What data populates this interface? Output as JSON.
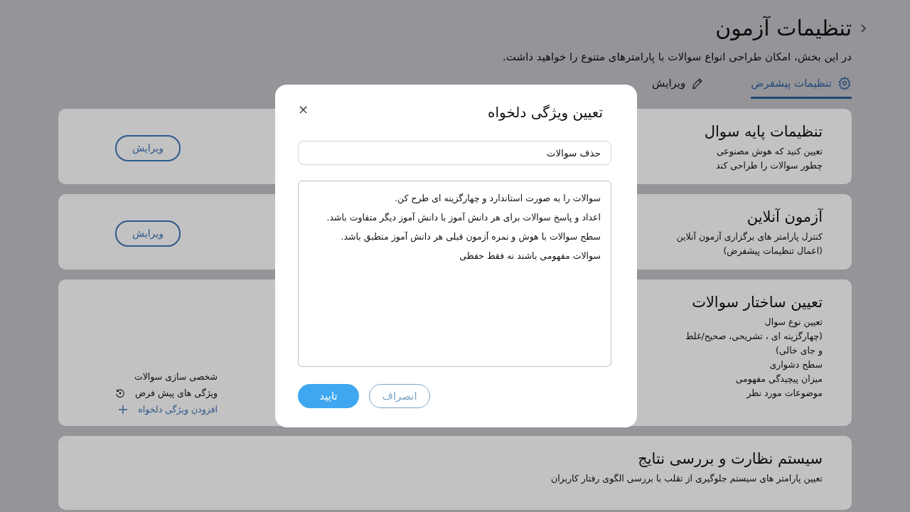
{
  "header": {
    "title": "تنظیمات آزمون",
    "subtitle": "در این بخش، امکان طراحی انواع سوالات با پارامترهای متنوع را خواهید داشت."
  },
  "tabs": [
    {
      "label": "تنظیمات پیشفرض",
      "kind": "settings",
      "selected": true
    },
    {
      "label": "ویرایش",
      "kind": "edit",
      "selected": false
    }
  ],
  "cards": [
    {
      "title": "تنظیمات پایه سوال",
      "description": [
        "تعیین کنید که هوش مصنوعی",
        "چطور سوالات را طراحی کند"
      ],
      "button": "ویرایش"
    },
    {
      "title": "آزمون آنلاین",
      "description": [
        "کنترل پارامتر های برگزاری آزمون آنلاین",
        "(اعمال تنظیمات پیشفرض)"
      ],
      "button": "ویرایش"
    },
    {
      "title": "تعیین ساختار سوالات",
      "description": [
        "تعیین نوع سوال",
        "(چهارگزینه ای ، تشریحی، صحیح/غلط",
        "و جای خالی)",
        "سطح دشواری",
        "میزان پیچیدگی مفهومی",
        "موضوعات مورد نظر"
      ],
      "customization": {
        "title": "شخصی سازی سوالات",
        "items": [
          {
            "kind": "default",
            "label": "ویژگی های پیش فرض"
          },
          {
            "kind": "add",
            "label": "افزودن ویژگی دلخواه"
          }
        ]
      }
    },
    {
      "title": "سیستم نظارت و بررسی نتایج",
      "description": [
        "تعیین پارامتر های سیستم جلوگیری از تقلب با بررسی الگوی رفتار کاربران"
      ]
    }
  ],
  "dialog": {
    "title": "تعیین ویژگی دلخواه",
    "close": "×",
    "name_field": {
      "value": "حذف سوالات"
    },
    "text_field": {
      "value": "سوالات را به صورت استاندارد و چهارگزینه ای طرح کن.\nاعداد و پاسخ سوالات برای هر دانش آموز با دانش آموز دیگر متفاوت باشد.\nسطح سوالات با هوش و نمره آزمون قبلی هر دانش آموز منطبق باشد.\nسوالات مفهومی باشند نه فقط حفظی"
    },
    "buttons": [
      {
        "kind": "secondary",
        "label": "انصراف"
      },
      {
        "kind": "primary",
        "label": "تایید"
      }
    ]
  }
}
